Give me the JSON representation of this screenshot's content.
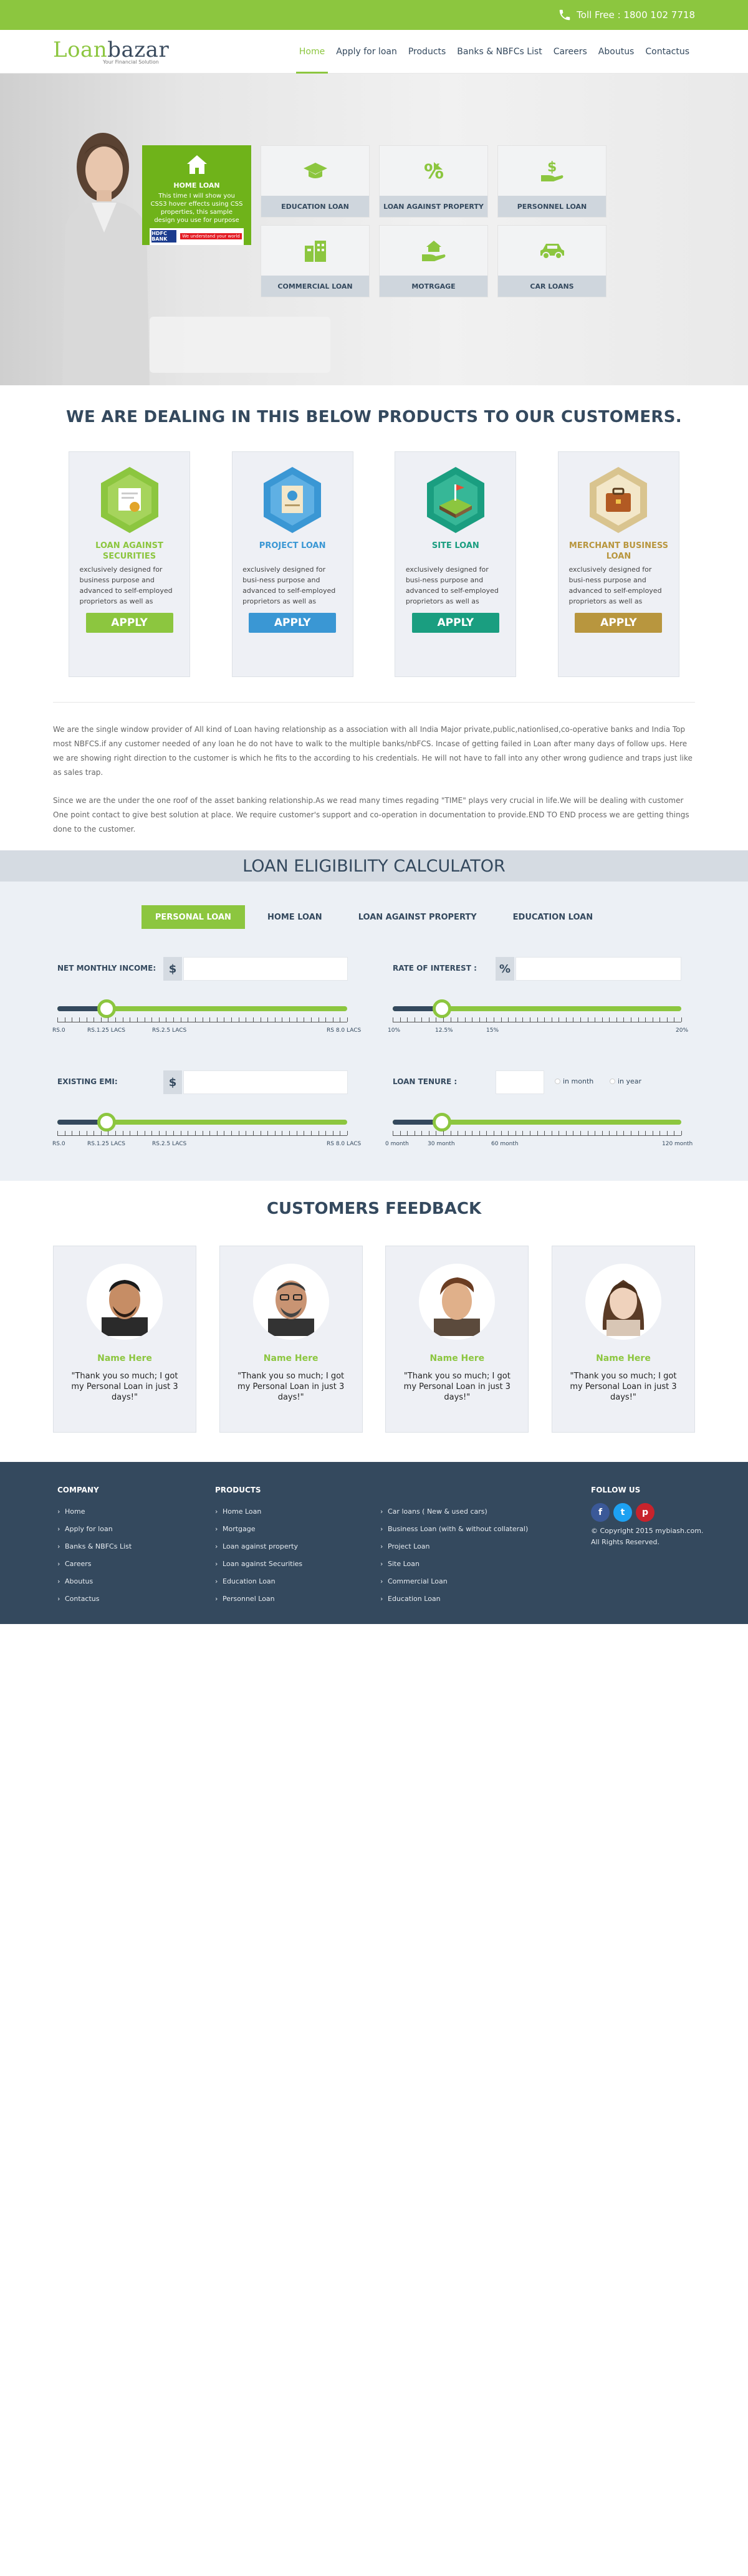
{
  "topbar": {
    "tollfree": "Toll Free : 1800 102 7718"
  },
  "header": {
    "logo_main": "Loan",
    "logo_bold": "bazar",
    "logo_tagline": "Your Financial Solution",
    "nav": [
      "Home",
      "Apply for loan",
      "Products",
      "Banks & NBFCs List",
      "Careers",
      "Aboutus",
      "Contactus"
    ],
    "active_nav": "Home"
  },
  "hero": {
    "tiles": [
      {
        "label": "HOME LOAN",
        "icon": "home-icon",
        "active": true
      },
      {
        "label": "EDUCATION LOAN",
        "icon": "graduation-cap-icon"
      },
      {
        "label": "LOAN AGAINST PROPERTY",
        "icon": "property-percent-icon"
      },
      {
        "label": "PERSONNEL LOAN",
        "icon": "hand-dollar-icon"
      },
      {
        "label": "COMMERCIAL LOAN",
        "icon": "buildings-icon"
      },
      {
        "label": "MOTRGAGE",
        "icon": "hand-home-icon"
      },
      {
        "label": "CAR LOANS",
        "icon": "car-icon"
      }
    ],
    "active_tile_text": "This time I will show you CSS3 hover effects using CSS properties, this sample design you use for purpose",
    "active_tile_bank": "HDFC BANK",
    "active_tile_bank_tag": "We understand your world"
  },
  "products": {
    "title": "WE ARE DEALING IN THIS BELOW PRODUCTS TO OUR CUSTOMERS.",
    "items": [
      {
        "name": "LOAN AGAINST SECURITIES",
        "color": "#8cc63f",
        "hex": "#8cc63f",
        "desc": "exclusively designed for business purpose and advanced to self-employed proprietors as well as entities",
        "apply": "APPLY"
      },
      {
        "name": "PROJECT LOAN",
        "color": "#3a97d4",
        "hex": "#3a97d4",
        "desc": "exclusively designed for busi-ness purpose and advanced to self-employed proprietors as well as entities such as",
        "apply": "APPLY"
      },
      {
        "name": "SITE LOAN",
        "color": "#1a9e80",
        "hex": "#1a9e80",
        "desc": "exclusively designed for busi-ness purpose and advanced to self-employed proprietors as well as entities such as",
        "apply": "APPLY"
      },
      {
        "name": "MERCHANT BUSINESS LOAN",
        "color": "#b8963e",
        "hex": "#b8963e",
        "desc": "exclusively designed for busi-ness purpose and advanced to self-employed proprietors as well as entities such as",
        "apply": "APPLY"
      }
    ]
  },
  "about": {
    "p1": "We are the single window provider of All kind of Loan having relationship as a association with all India Major private,public,nationlised,co-operative banks and India Top most NBFCS.if any customer needed of any loan he do not have to walk to the multiple banks/nbFCS. Incase of getting failed in Loan after many days of follow ups. Here we are showing right direction to the customer is which he fits to the according to his credentials. He will not have to fall into any other wrong gudience and traps just like as sales trap.",
    "p2": "Since we are the under the one roof of the asset banking relationship.As we read many times regading \"TIME\" plays very crucial in life.We will be dealing with customer One point contact to give best solution at place. We require customer's support and co-operation in documentation to provide.END TO END process we are getting things done to the customer."
  },
  "calculator": {
    "title": "LOAN ELIGIBILITY CALCULATOR",
    "tabs": [
      "PERSONAL LOAN",
      "HOME LOAN",
      "LOAN AGAINST PROPERTY",
      "EDUCATION LOAN"
    ],
    "active_tab": "PERSONAL LOAN",
    "income": {
      "label": "NET MONTHLY INCOME:",
      "prefix": "$",
      "ticks": [
        "RS.0",
        "RS.1.25 LACS",
        "RS.2.5 LACS",
        "RS 8.0 LACS"
      ],
      "level": 0.17
    },
    "rate": {
      "label": "RATE OF INTEREST :",
      "prefix": "%",
      "ticks": [
        "10%",
        "12.5%",
        "15%",
        "20%"
      ],
      "level": 0.17
    },
    "emi": {
      "label": "EXISTING EMI:",
      "prefix": "$",
      "ticks": [
        "RS.0",
        "RS.1.25 LACS",
        "RS.2.5 LACS",
        "RS 8.0 LACS"
      ],
      "level": 0.17
    },
    "tenure": {
      "label": "LOAN TENURE :",
      "options": [
        "in month",
        "in year"
      ],
      "ticks": [
        "0 month",
        "30 month",
        "60 month",
        "120 month"
      ],
      "level": 0.17
    }
  },
  "feedback": {
    "title": "CUSTOMERS FEEDBACK",
    "items": [
      {
        "name": "Name Here",
        "quote": "\"Thank you so much; I got my Personal Loan in just 3 days!\""
      },
      {
        "name": "Name Here",
        "quote": "\"Thank you so much; I got my Personal Loan in just 3 days!\""
      },
      {
        "name": "Name Here",
        "quote": "\"Thank you so much; I got my Personal Loan in just 3 days!\""
      },
      {
        "name": "Name Here",
        "quote": "\"Thank you so much; I got my Personal Loan in just 3 days!\""
      }
    ]
  },
  "footer": {
    "company_title": "COMPANY",
    "company": [
      "Home",
      "Apply for loan",
      "Banks & NBFCs List",
      "Careers",
      "Aboutus",
      "Contactus"
    ],
    "products_title": "PRODUCTS",
    "products1": [
      "Home Loan",
      "Mortgage",
      "Loan against property",
      "Loan against Securities",
      "Education Loan",
      "Personnel Loan"
    ],
    "products2": [
      "Car loans ( New & used cars)",
      "Business Loan (with & without collateral)",
      "Project Loan",
      "Site Loan",
      "Commercial Loan",
      "Education Loan"
    ],
    "follow_title": "FOLLOW US",
    "social": [
      {
        "icon": "facebook-icon",
        "glyph": "f",
        "color": "#3b5998"
      },
      {
        "icon": "twitter-icon",
        "glyph": "t",
        "color": "#1da1f2"
      },
      {
        "icon": "pinterest-icon",
        "glyph": "p",
        "color": "#c8232c"
      }
    ],
    "copyright": "© Copyright 2015 mybiash.com.",
    "rights": "All Rights Reserved."
  }
}
